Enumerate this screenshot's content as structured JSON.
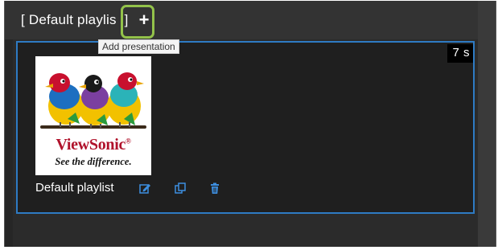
{
  "header": {
    "playlist_title": "[ Default playlis",
    "playlist_title_close": "]",
    "add_icon_glyph": "+",
    "tooltip": "Add presentation"
  },
  "card": {
    "duration": "7 s",
    "label": "Default playlist",
    "thumbnail": {
      "brand_name": "ViewSonic",
      "brand_trademark": "®",
      "tagline": "See the difference."
    },
    "icons": [
      "edit-icon",
      "copy-icon",
      "trash-icon"
    ]
  },
  "colors": {
    "accent_border": "#2e7bc4",
    "icon_blue": "#3d8fe0",
    "highlight": "#93c24a",
    "background": "#2b2b2b",
    "brand_red": "#b0122b"
  }
}
